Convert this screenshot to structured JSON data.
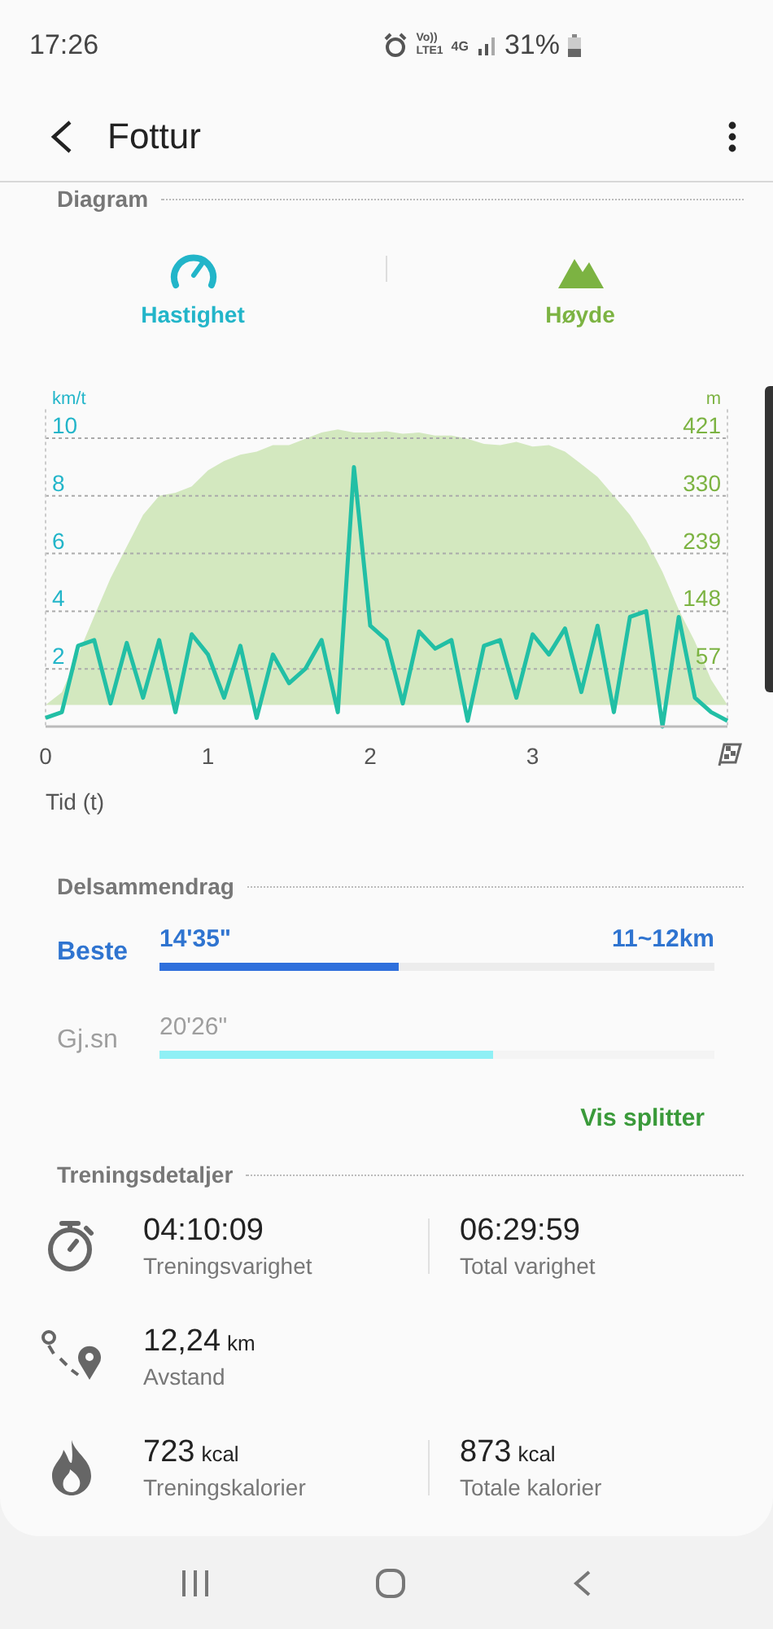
{
  "status_bar": {
    "time": "17:26",
    "network_top": "Vo))",
    "network_bottom": "LTE1",
    "data": "4G",
    "battery": "31%"
  },
  "app_bar": {
    "title": "Fottur"
  },
  "diagram": {
    "heading": "Diagram",
    "toggles": [
      {
        "kind": "speed",
        "on": true
      },
      {
        "kind": "altitude",
        "on": true
      }
    ],
    "charts": [
      {
        "chart_data": {
          "type": "line",
          "ylabel": "km/t",
          "xlabel": "Tid (t)",
          "grid": true,
          "x": [
            0,
            0.1,
            0.2,
            0.3,
            0.4,
            0.5,
            0.6,
            0.7,
            0.8,
            0.9,
            1.0,
            1.1,
            1.2,
            1.3,
            1.4,
            1.5,
            1.6,
            1.7,
            1.8,
            1.9,
            2.0,
            2.1,
            2.2,
            2.3,
            2.4,
            2.5,
            2.6,
            2.7,
            2.8,
            2.9,
            3.0,
            3.1,
            3.2,
            3.3,
            3.4,
            3.5,
            3.6,
            3.7,
            3.8,
            3.9,
            4.0,
            4.1,
            4.2
          ],
          "series": [
            {
              "name": "Hastighet",
              "color": "#22bfa5",
              "values": [
                0.3,
                0.5,
                2.8,
                3.0,
                0.8,
                2.9,
                1.0,
                3.0,
                0.5,
                3.2,
                2.5,
                1.0,
                2.8,
                0.3,
                2.5,
                1.5,
                2.0,
                3.0,
                0.5,
                9.0,
                3.5,
                3.0,
                0.8,
                3.3,
                2.7,
                3.0,
                0.2,
                2.8,
                3.0,
                1.0,
                3.2,
                2.5,
                3.4,
                1.2,
                3.5,
                0.5,
                3.8,
                4.0,
                0.0,
                3.8,
                1.0,
                0.5,
                0.2
              ]
            }
          ],
          "xlim": [
            0,
            4.2
          ],
          "ylim": [
            0,
            11
          ],
          "xticks": [
            0,
            1,
            2,
            3
          ],
          "yticks": [
            2,
            4,
            6,
            8,
            10
          ]
        }
      },
      {
        "chart_data": {
          "type": "area",
          "ylabel": "m",
          "x": [
            0,
            0.1,
            0.2,
            0.3,
            0.4,
            0.5,
            0.6,
            0.7,
            0.8,
            0.9,
            1.0,
            1.1,
            1.2,
            1.3,
            1.4,
            1.5,
            1.6,
            1.7,
            1.8,
            1.9,
            2.0,
            2.1,
            2.2,
            2.3,
            2.4,
            2.5,
            2.6,
            2.7,
            2.8,
            2.9,
            3.0,
            3.1,
            3.2,
            3.3,
            3.4,
            3.5,
            3.6,
            3.7,
            3.8,
            3.9,
            4.0,
            4.1,
            4.2
          ],
          "series": [
            {
              "name": "Høyde",
              "color": "#d3e8bf",
              "values": [
                0,
                20,
                80,
                140,
                200,
                250,
                300,
                330,
                335,
                345,
                370,
                385,
                395,
                400,
                410,
                410,
                420,
                430,
                435,
                430,
                430,
                432,
                428,
                430,
                425,
                425,
                420,
                412,
                410,
                415,
                408,
                410,
                400,
                380,
                360,
                330,
                300,
                260,
                210,
                150,
                100,
                40,
                0
              ]
            }
          ],
          "xlim": [
            0,
            4.2
          ],
          "ylim": [
            -34,
            466.5
          ],
          "yticks": [
            57,
            148,
            239,
            330,
            421
          ]
        }
      }
    ]
  },
  "splits": {
    "heading": "Delsammendrag",
    "rows": [
      {
        "kind": "best",
        "label": "Beste",
        "time": "14'35\"",
        "distance": "11~12km",
        "level": 0.43
      },
      {
        "kind": "average",
        "label": "Gj.sn",
        "time": "20'26\"",
        "level": 0.6
      }
    ],
    "link": "Vis splitter"
  },
  "details": {
    "heading": "Treningsdetaljer",
    "rows": [
      {
        "kind": "duration",
        "items": [
          {
            "value": "04:10:09",
            "label": "Treningsvarighet"
          },
          {
            "value": "06:29:59",
            "label": "Total varighet"
          }
        ]
      },
      {
        "kind": "distance",
        "items": [
          {
            "value": "12,24",
            "unit": "km",
            "label": "Avstand"
          }
        ]
      },
      {
        "kind": "calories",
        "items": [
          {
            "value": "723",
            "unit": "kcal",
            "label": "Treningskalorier"
          },
          {
            "value": "873",
            "unit": "kcal",
            "label": "Totale kalorier"
          }
        ]
      }
    ]
  }
}
